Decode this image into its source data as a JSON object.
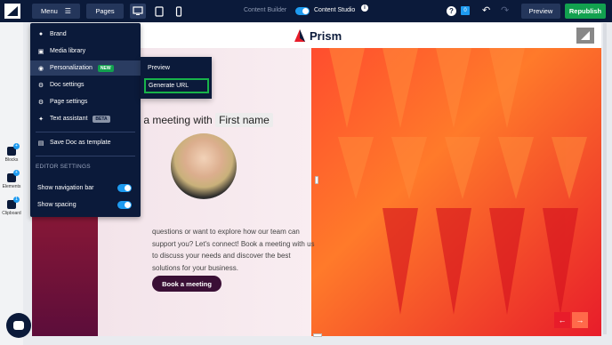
{
  "topbar": {
    "menu_label": "Menu",
    "pages_label": "Pages",
    "content_builder_label": "Content Builder",
    "content_studio_label": "Content Studio",
    "notification_count": "0",
    "preview_label": "Preview",
    "republish_label": "Republish"
  },
  "colors": {
    "topbar_bg": "#0b1a3a",
    "accent_blue": "#1e9bf0",
    "republish_green": "#12a14f",
    "cta_bg": "#3a0f35",
    "highlight_green": "#18b34a",
    "hero_red": "#e81c2a"
  },
  "leftbar": {
    "tools": [
      {
        "label": "Blocks",
        "icon": "blocks-icon"
      },
      {
        "label": "Elements",
        "icon": "elements-icon"
      },
      {
        "label": "Clipboard",
        "icon": "clipboard-icon",
        "badge": "1"
      }
    ]
  },
  "menu": {
    "items": [
      {
        "label": "Brand",
        "icon": "palette-icon"
      },
      {
        "label": "Media library",
        "icon": "image-icon"
      },
      {
        "label": "Personalization",
        "icon": "person-icon",
        "tag": "NEW",
        "active": true
      },
      {
        "label": "Doc settings",
        "icon": "gear-icon"
      },
      {
        "label": "Page settings",
        "icon": "gear-icon"
      },
      {
        "label": "Text assistant",
        "icon": "magic-wand-icon",
        "tag": "BETA"
      },
      {
        "label": "Save Doc as template",
        "icon": "template-icon"
      }
    ],
    "section_title": "EDITOR SETTINGS",
    "toggles": [
      {
        "label": "Show navigation bar",
        "on": true
      },
      {
        "label": "Show spacing",
        "on": true
      }
    ]
  },
  "submenu": {
    "items": [
      {
        "label": "Preview"
      },
      {
        "label": "Generate URL",
        "highlighted": true
      }
    ]
  },
  "canvas": {
    "brand_name": "Prism",
    "headline_prefix": "k a meeting with",
    "headline_chip": "First name",
    "body_text": "questions or want to explore how our team can support you? Let's connect! Book a meeting with us to discuss your needs and discover the best solutions for your business.",
    "cta_label": "Book a meeting"
  }
}
